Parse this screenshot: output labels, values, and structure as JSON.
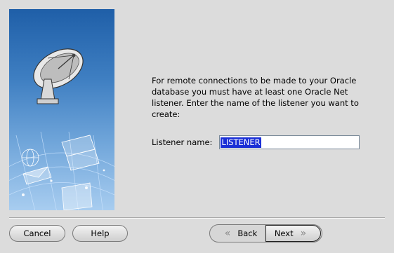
{
  "description": "For remote connections to be made to your Oracle database you must have at least one Oracle Net listener. Enter the name of the listener you want to create:",
  "listener_field": {
    "label": "Listener name:",
    "value": "LISTENER"
  },
  "buttons": {
    "cancel": "Cancel",
    "help": "Help",
    "back": "Back",
    "next": "Next"
  },
  "icons": {
    "back": "chevron-double-left-icon",
    "next": "chevron-double-right-icon",
    "banner": "satellite-dish-illustration"
  },
  "colors": {
    "selection": "#1a2fd6",
    "banner_top": "#1f5fa8",
    "banner_bottom": "#a8cdf0"
  }
}
